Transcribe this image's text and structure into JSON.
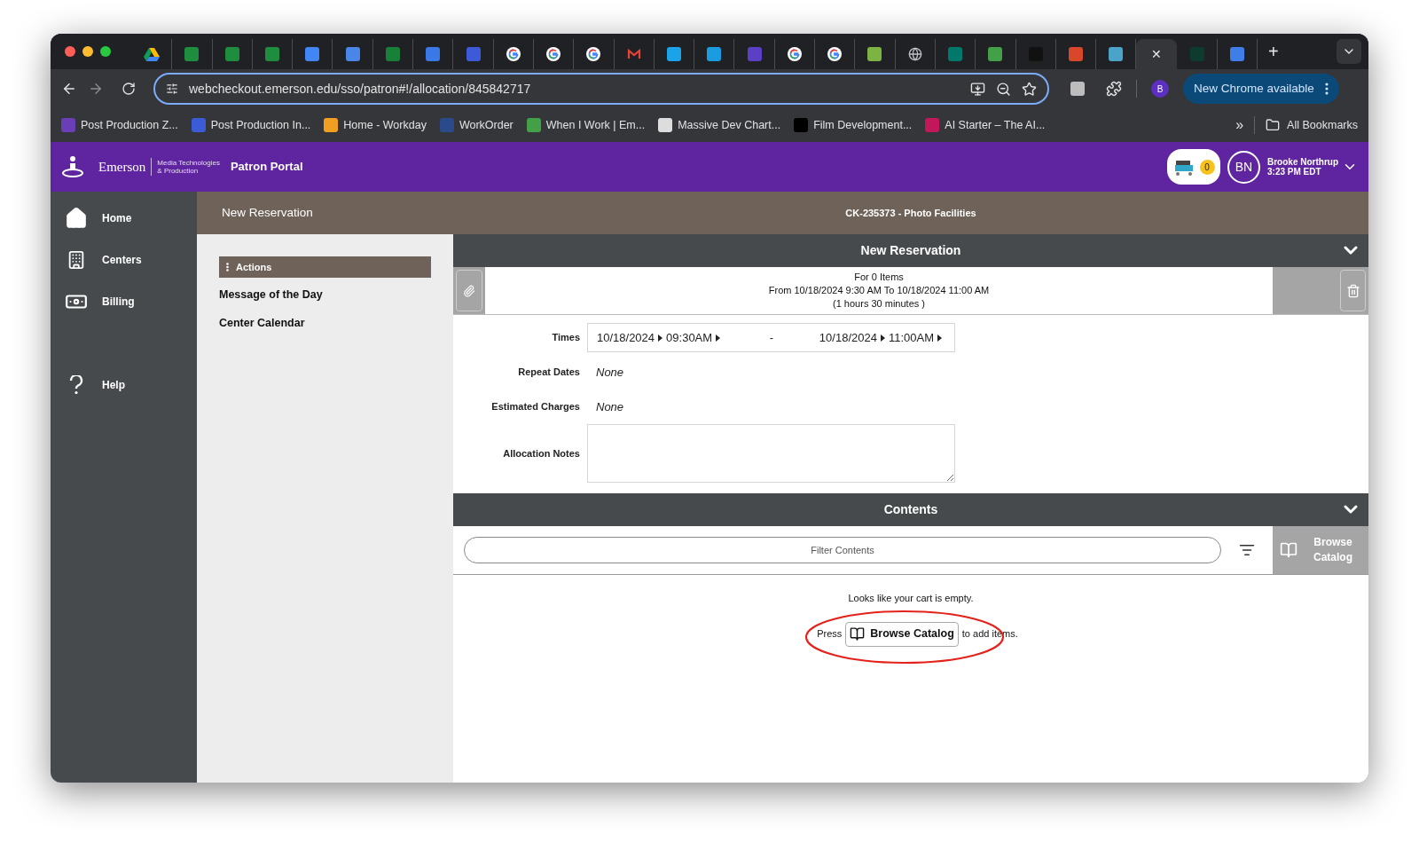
{
  "browser": {
    "tabs": [
      {
        "kind": "drive",
        "selected": false
      },
      {
        "kind": "tile",
        "color": "#1e8e3e",
        "selected": false
      },
      {
        "kind": "tile",
        "color": "#1e8e3e",
        "selected": false
      },
      {
        "kind": "tile",
        "color": "#1e8e3e",
        "selected": false
      },
      {
        "kind": "tile",
        "color": "#4285f4",
        "selected": false
      },
      {
        "kind": "tile",
        "color": "#4a86e8",
        "selected": false
      },
      {
        "kind": "tile",
        "color": "#188038",
        "selected": false
      },
      {
        "kind": "tile",
        "color": "#3b78e7",
        "selected": false
      },
      {
        "kind": "tile",
        "color": "#3d5bd9",
        "selected": false
      },
      {
        "kind": "google",
        "selected": false
      },
      {
        "kind": "google",
        "selected": false
      },
      {
        "kind": "google",
        "selected": false
      },
      {
        "kind": "gmail",
        "selected": false
      },
      {
        "kind": "tile",
        "color": "#1aa3e8",
        "selected": false
      },
      {
        "kind": "tile",
        "color": "#1b9be0",
        "selected": false
      },
      {
        "kind": "tile",
        "color": "#5b3fc4",
        "selected": false
      },
      {
        "kind": "google",
        "selected": false
      },
      {
        "kind": "google",
        "selected": false
      },
      {
        "kind": "tile",
        "color": "#7cb342",
        "selected": false
      },
      {
        "kind": "globe",
        "selected": false
      },
      {
        "kind": "tile",
        "color": "#00796b",
        "selected": false
      },
      {
        "kind": "tile",
        "color": "#43a047",
        "selected": false
      },
      {
        "kind": "tile",
        "color": "#111111",
        "selected": false
      },
      {
        "kind": "tile",
        "color": "#d9472b",
        "selected": false
      },
      {
        "kind": "tile",
        "color": "#4aa3c9",
        "selected": false
      },
      {
        "kind": "blank",
        "selected": true,
        "close": "✕"
      },
      {
        "kind": "tile",
        "color": "#0d3b2e",
        "selected": false
      },
      {
        "kind": "tile",
        "color": "#3f7ee8",
        "selected": false
      }
    ],
    "new_tab": "+",
    "url": "webcheckout.emerson.edu/sso/patron#!/allocation/845842717",
    "profile_initial": "B",
    "update_button": "New Chrome available",
    "bookmarks": [
      {
        "label": "Post Production Z...",
        "color": "#6a3fb5"
      },
      {
        "label": "Post Production In...",
        "color": "#3c5bd6"
      },
      {
        "label": "Home - Workday",
        "color": "#f0a020"
      },
      {
        "label": "WorkOrder",
        "color": "#2b4a8c"
      },
      {
        "label": "When I Work | Em...",
        "color": "#43a047"
      },
      {
        "label": "Massive Dev Chart...",
        "color": "#dddddd"
      },
      {
        "label": "Film Development...",
        "color": "#000000"
      },
      {
        "label": "AI Starter – The AI...",
        "color": "#c2185b"
      }
    ],
    "overflow": "»",
    "all_bookmarks": "All Bookmarks"
  },
  "header": {
    "brand": "Emerson",
    "brand_sub": [
      "Media Technologies",
      "& Production"
    ],
    "portal": "Patron Portal",
    "cart_count": "0",
    "initials": "BN",
    "user_name": "Brooke Northrup",
    "time": "3:23 PM EDT"
  },
  "nav": {
    "main": [
      {
        "label": "Home",
        "kind": "home"
      },
      {
        "label": "Centers",
        "kind": "building"
      },
      {
        "label": "Billing",
        "kind": "money"
      }
    ],
    "footer": [
      {
        "label": "Help",
        "kind": "help"
      }
    ]
  },
  "page_title": "New Reservation",
  "center": "CK-235373 - Photo Facilities",
  "actions": {
    "title": "Actions",
    "items": [
      "Message of the Day",
      "Center Calendar"
    ]
  },
  "reservation": {
    "title": "New Reservation",
    "expanded": true,
    "summary": [
      "For 0 Items",
      "From 10/18/2024 9:30 AM To 10/18/2024 11:00 AM",
      "(1 hours 30 minutes )"
    ],
    "fields": [
      {
        "kind": "times",
        "label": "Times",
        "start_date": "10/18/2024",
        "start_time": "09:30AM",
        "separator": "-",
        "end_date": "10/18/2024",
        "end_time": "11:00AM"
      },
      {
        "kind": "text",
        "label": "Repeat Dates",
        "value": "None"
      },
      {
        "kind": "text",
        "label": "Estimated Charges",
        "value": "None"
      },
      {
        "kind": "textarea",
        "label": "Allocation Notes"
      }
    ]
  },
  "contents": {
    "title": "Contents",
    "expanded": true,
    "filter_placeholder": "Filter Contents",
    "browse_button": "Browse Catalog",
    "empty_message": "Looks like your cart is empty.",
    "prompt_before": "Press",
    "prompt_button": "Browse Catalog",
    "prompt_after": "to add items."
  },
  "annotation": {
    "kind": "ellipse"
  }
}
